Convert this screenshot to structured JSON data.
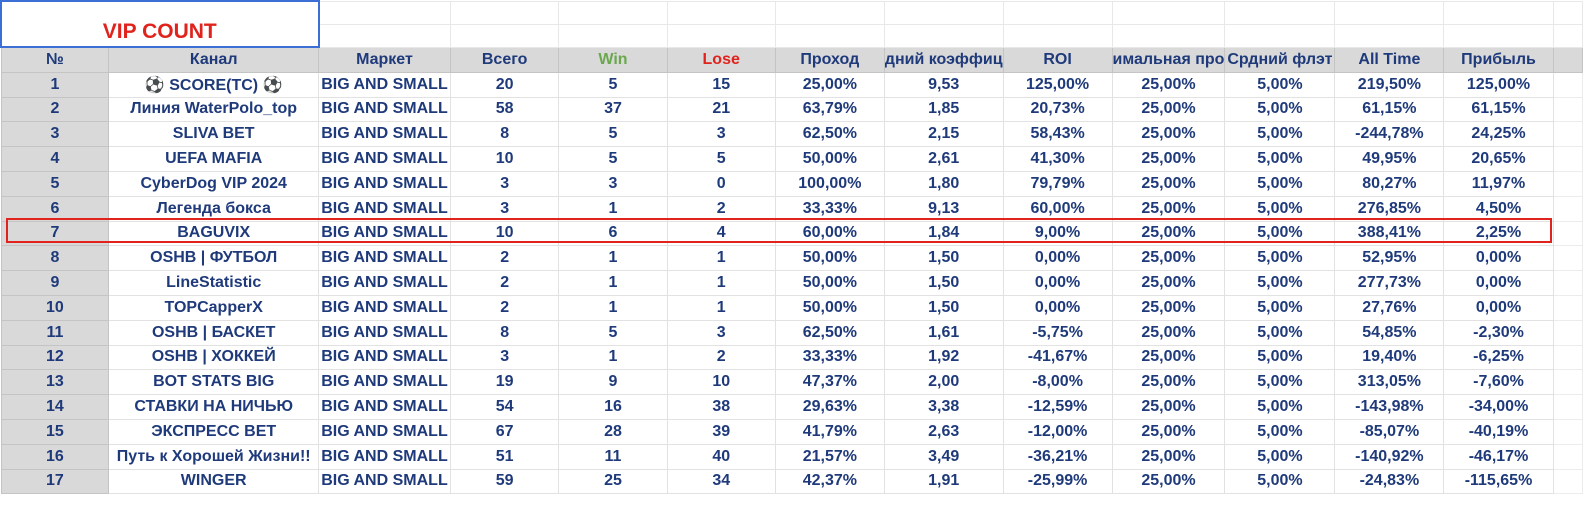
{
  "title": "VIP COUNT",
  "colors": {
    "title": "#e0231d",
    "win": "#6aa84f",
    "lose": "#e0231d",
    "text": "#1f3a7a",
    "highlight": "#e0231d"
  },
  "headers": [
    "№",
    "Канал",
    "Маркет",
    "Всего",
    "Win",
    "Lose",
    "Проход",
    "дний коэффиц",
    "ROI",
    "имальная про",
    "Срдний флэт",
    "All Time",
    "Прибыль"
  ],
  "rows": [
    {
      "n": "1",
      "channel": "⚽ SCORE(TC) ⚽",
      "market": "BIG AND SMALL",
      "total": "20",
      "win": "5",
      "lose": "15",
      "pass": "25,00%",
      "coef": "9,53",
      "roi": "125,00%",
      "maxp": "25,00%",
      "flat": "5,00%",
      "alltime": "219,50%",
      "profit": "125,00%"
    },
    {
      "n": "2",
      "channel": "Линия WaterPolo_top",
      "market": "BIG AND SMALL",
      "total": "58",
      "win": "37",
      "lose": "21",
      "pass": "63,79%",
      "coef": "1,85",
      "roi": "20,73%",
      "maxp": "25,00%",
      "flat": "5,00%",
      "alltime": "61,15%",
      "profit": "61,15%"
    },
    {
      "n": "3",
      "channel": "SLIVA BET",
      "market": "BIG AND SMALL",
      "total": "8",
      "win": "5",
      "lose": "3",
      "pass": "62,50%",
      "coef": "2,15",
      "roi": "58,43%",
      "maxp": "25,00%",
      "flat": "5,00%",
      "alltime": "-244,78%",
      "profit": "24,25%"
    },
    {
      "n": "4",
      "channel": "UEFA MAFIA",
      "market": "BIG AND SMALL",
      "total": "10",
      "win": "5",
      "lose": "5",
      "pass": "50,00%",
      "coef": "2,61",
      "roi": "41,30%",
      "maxp": "25,00%",
      "flat": "5,00%",
      "alltime": "49,95%",
      "profit": "20,65%"
    },
    {
      "n": "5",
      "channel": "CyberDog VIP 2024",
      "market": "BIG AND SMALL",
      "total": "3",
      "win": "3",
      "lose": "0",
      "pass": "100,00%",
      "coef": "1,80",
      "roi": "79,79%",
      "maxp": "25,00%",
      "flat": "5,00%",
      "alltime": "80,27%",
      "profit": "11,97%"
    },
    {
      "n": "6",
      "channel": "Легенда бокса",
      "market": "BIG AND SMALL",
      "total": "3",
      "win": "1",
      "lose": "2",
      "pass": "33,33%",
      "coef": "9,13",
      "roi": "60,00%",
      "maxp": "25,00%",
      "flat": "5,00%",
      "alltime": "276,85%",
      "profit": "4,50%"
    },
    {
      "n": "7",
      "channel": "BAGUVIX",
      "market": "BIG AND SMALL",
      "total": "10",
      "win": "6",
      "lose": "4",
      "pass": "60,00%",
      "coef": "1,84",
      "roi": "9,00%",
      "maxp": "25,00%",
      "flat": "5,00%",
      "alltime": "388,41%",
      "profit": "2,25%"
    },
    {
      "n": "8",
      "channel": "OSHB | ФУТБОЛ",
      "market": "BIG AND SMALL",
      "total": "2",
      "win": "1",
      "lose": "1",
      "pass": "50,00%",
      "coef": "1,50",
      "roi": "0,00%",
      "maxp": "25,00%",
      "flat": "5,00%",
      "alltime": "52,95%",
      "profit": "0,00%"
    },
    {
      "n": "9",
      "channel": "LineStatistic",
      "market": "BIG AND SMALL",
      "total": "2",
      "win": "1",
      "lose": "1",
      "pass": "50,00%",
      "coef": "1,50",
      "roi": "0,00%",
      "maxp": "25,00%",
      "flat": "5,00%",
      "alltime": "277,73%",
      "profit": "0,00%"
    },
    {
      "n": "10",
      "channel": "TOPCapperX",
      "market": "BIG AND SMALL",
      "total": "2",
      "win": "1",
      "lose": "1",
      "pass": "50,00%",
      "coef": "1,50",
      "roi": "0,00%",
      "maxp": "25,00%",
      "flat": "5,00%",
      "alltime": "27,76%",
      "profit": "0,00%"
    },
    {
      "n": "11",
      "channel": "OSHB | БАСКЕТ",
      "market": "BIG AND SMALL",
      "total": "8",
      "win": "5",
      "lose": "3",
      "pass": "62,50%",
      "coef": "1,61",
      "roi": "-5,75%",
      "maxp": "25,00%",
      "flat": "5,00%",
      "alltime": "54,85%",
      "profit": "-2,30%"
    },
    {
      "n": "12",
      "channel": "OSHB | ХОККЕЙ",
      "market": "BIG AND SMALL",
      "total": "3",
      "win": "1",
      "lose": "2",
      "pass": "33,33%",
      "coef": "1,92",
      "roi": "-41,67%",
      "maxp": "25,00%",
      "flat": "5,00%",
      "alltime": "19,40%",
      "profit": "-6,25%"
    },
    {
      "n": "13",
      "channel": "BOT STATS BIG",
      "market": "BIG AND SMALL",
      "total": "19",
      "win": "9",
      "lose": "10",
      "pass": "47,37%",
      "coef": "2,00",
      "roi": "-8,00%",
      "maxp": "25,00%",
      "flat": "5,00%",
      "alltime": "313,05%",
      "profit": "-7,60%"
    },
    {
      "n": "14",
      "channel": "СТАВКИ НА НИЧЬЮ",
      "market": "BIG AND SMALL",
      "total": "54",
      "win": "16",
      "lose": "38",
      "pass": "29,63%",
      "coef": "3,38",
      "roi": "-12,59%",
      "maxp": "25,00%",
      "flat": "5,00%",
      "alltime": "-143,98%",
      "profit": "-34,00%"
    },
    {
      "n": "15",
      "channel": "ЭКСПРЕСС BET",
      "market": "BIG AND SMALL",
      "total": "67",
      "win": "28",
      "lose": "39",
      "pass": "41,79%",
      "coef": "2,63",
      "roi": "-12,00%",
      "maxp": "25,00%",
      "flat": "5,00%",
      "alltime": "-85,07%",
      "profit": "-40,19%"
    },
    {
      "n": "16",
      "channel": "Путь к Хорошей Жизни!!",
      "market": "BIG AND SMALL",
      "total": "51",
      "win": "11",
      "lose": "40",
      "pass": "21,57%",
      "coef": "3,49",
      "roi": "-36,21%",
      "maxp": "25,00%",
      "flat": "5,00%",
      "alltime": "-140,92%",
      "profit": "-46,17%"
    },
    {
      "n": "17",
      "channel": "WINGER",
      "market": "BIG AND SMALL",
      "total": "59",
      "win": "25",
      "lose": "34",
      "pass": "42,37%",
      "coef": "1,91",
      "roi": "-25,99%",
      "maxp": "25,00%",
      "flat": "5,00%",
      "alltime": "-24,83%",
      "profit": "-115,65%"
    }
  ],
  "highlighted_row": "7"
}
